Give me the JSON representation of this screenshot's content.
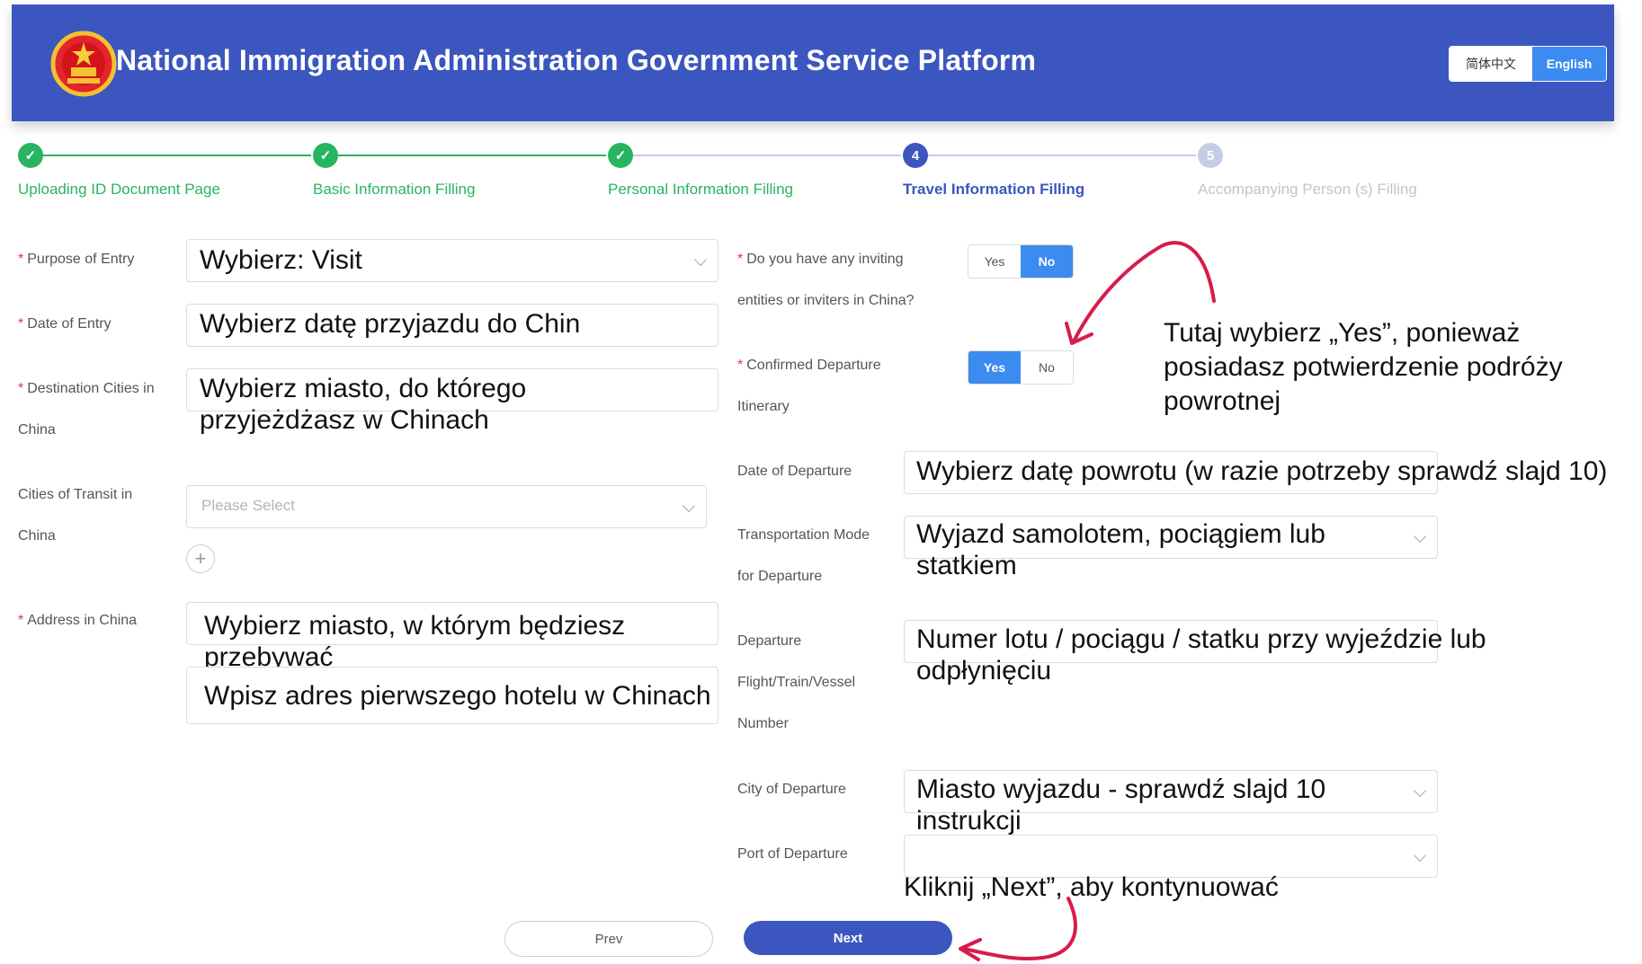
{
  "header": {
    "title": "National Immigration Administration Government Service Platform",
    "lang_zh": "简体中文",
    "lang_en": "English"
  },
  "steps": [
    {
      "label": "Uploading ID Document Page",
      "state": "done"
    },
    {
      "label": "Basic Information Filling",
      "state": "done"
    },
    {
      "label": "Personal Information Filling",
      "state": "done"
    },
    {
      "label": "Travel Information Filling",
      "state": "active",
      "number": "4"
    },
    {
      "label": "Accompanying Person (s) Filling",
      "state": "pending",
      "number": "5"
    }
  ],
  "left_form": {
    "purpose_label": "Purpose of Entry",
    "purpose_value": "Wybierz: Visit",
    "date_entry_label": "Date of Entry",
    "date_entry_value": "Wybierz datę przyjazdu do Chin",
    "dest_label_1": "Destination Cities in",
    "dest_label_2": "China",
    "dest_value": "Wybierz miasto, do którego przyjeżdżasz w Chinach",
    "transit_label_1": "Cities of Transit in",
    "transit_label_2": "China",
    "transit_placeholder": "Please Select",
    "add_symbol": "+",
    "address_label": "Address in China",
    "address_city_value": "Wybierz miasto, w którym będziesz przebywać",
    "address_detail_value": "Wpisz adres pierwszego hotelu w Chinach"
  },
  "right_form": {
    "inviting_label_1": "Do you have any inviting",
    "inviting_label_2": "entities or inviters in China?",
    "inviting_yes": "Yes",
    "inviting_no": "No",
    "confirmed_label_1": "Confirmed Departure",
    "confirmed_label_2": "Itinerary",
    "confirmed_yes": "Yes",
    "confirmed_no": "No",
    "date_departure_label": "Date of Departure",
    "date_departure_value": "Wybierz datę powrotu (w razie potrzeby sprawdź slajd 10)",
    "transport_label_1": "Transportation Mode",
    "transport_label_2": "for Departure",
    "transport_value": "Wyjazd samolotem, pociągiem lub statkiem",
    "flight_label_1": "Departure",
    "flight_label_2": "Flight/Train/Vessel",
    "flight_label_3": "Number",
    "flight_value": "Numer lotu / pociągu / statku przy wyjeździe lub odpłynięciu",
    "city_departure_label": "City of Departure",
    "city_departure_value": "Miasto wyjazdu - sprawdź slajd 10 instrukcji",
    "port_departure_label": "Port of Departure",
    "port_departure_value": ""
  },
  "annotations": {
    "yes_note": "Tutaj wybierz „Yes”, ponieważ posiadasz potwierdzenie podróży powrotnej",
    "next_note": "Kliknij „Next”, aby kontynuować"
  },
  "buttons": {
    "prev": "Prev",
    "next": "Next"
  },
  "colors": {
    "header_bg": "#3c56bf",
    "done_green": "#28b55f",
    "active_blue": "#3c56bf",
    "toggle_blue": "#3b8bf0",
    "required_red": "#e8333d",
    "arrow_red": "#d81b4a"
  }
}
